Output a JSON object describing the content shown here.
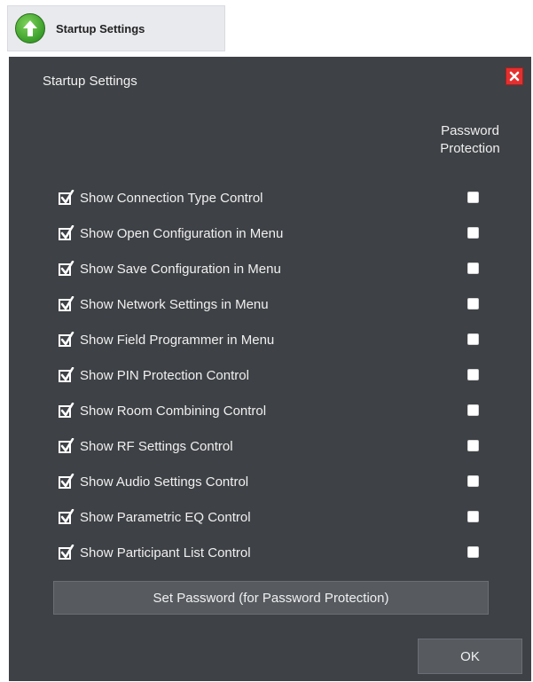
{
  "launcher": {
    "label": "Startup Settings",
    "icon": "up-arrow-icon",
    "accent": "#3a9e2a"
  },
  "dialog": {
    "title": "Startup Settings",
    "close_icon": "close-icon",
    "password_header_line1": "Password",
    "password_header_line2": "Protection",
    "settings": [
      {
        "label": "Show Connection Type Control",
        "checked": true,
        "password_protected": false
      },
      {
        "label": "Show Open Configuration in Menu",
        "checked": true,
        "password_protected": false
      },
      {
        "label": "Show Save Configuration in Menu",
        "checked": true,
        "password_protected": false
      },
      {
        "label": "Show Network Settings in Menu",
        "checked": true,
        "password_protected": false
      },
      {
        "label": "Show Field Programmer in Menu",
        "checked": true,
        "password_protected": false
      },
      {
        "label": "Show PIN Protection Control",
        "checked": true,
        "password_protected": false
      },
      {
        "label": "Show Room Combining Control",
        "checked": true,
        "password_protected": false
      },
      {
        "label": "Show RF Settings Control",
        "checked": true,
        "password_protected": false
      },
      {
        "label": "Show Audio Settings Control",
        "checked": true,
        "password_protected": false
      },
      {
        "label": "Show Parametric EQ Control",
        "checked": true,
        "password_protected": false
      },
      {
        "label": "Show Participant List Control",
        "checked": true,
        "password_protected": false
      }
    ],
    "set_password_label": "Set Password (for Password Protection)",
    "ok_label": "OK",
    "colors": {
      "background": "#3e4145",
      "button": "#575b60",
      "close": "#e3302f"
    }
  }
}
